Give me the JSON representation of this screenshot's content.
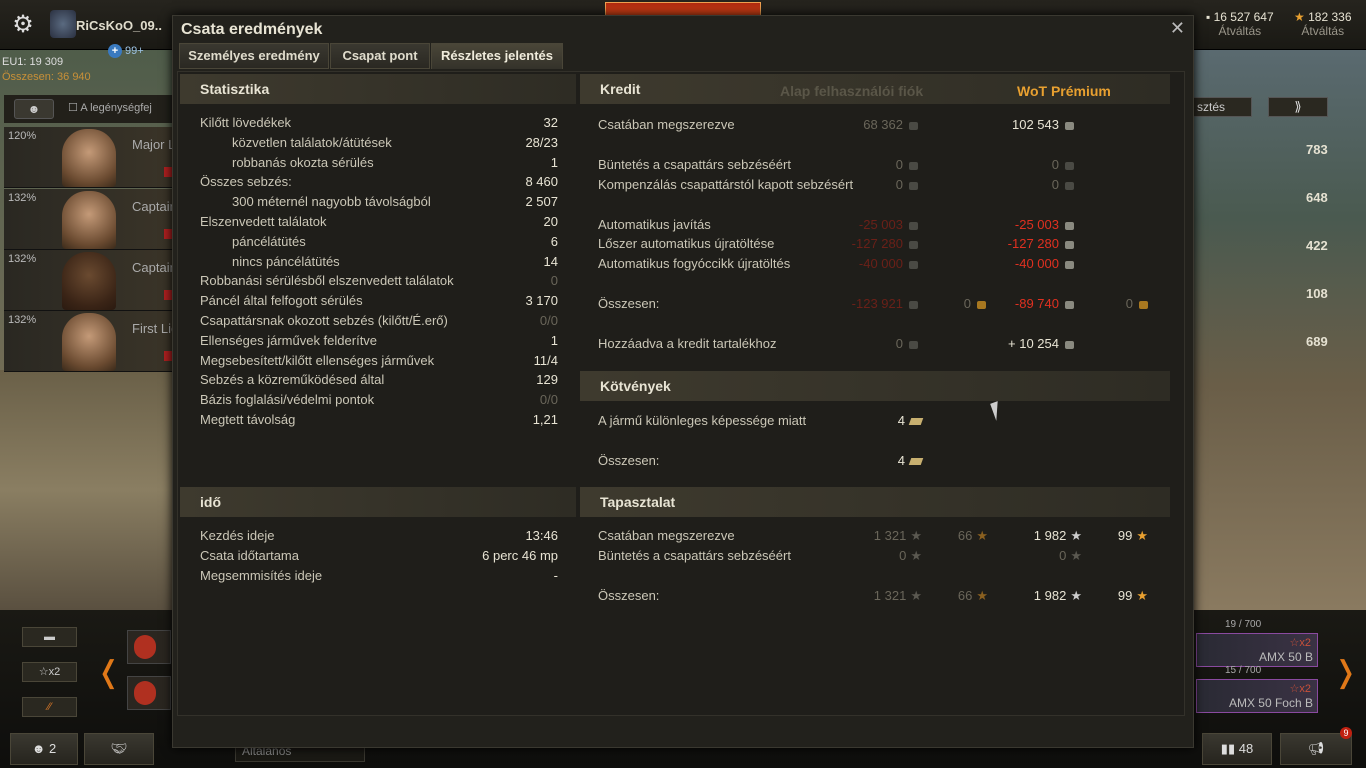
{
  "topbar": {
    "player_name": "RiCsKoO_09..",
    "invites_badge": "99+",
    "currencies": [
      {
        "value": "16 527 647",
        "label": "Átváltás"
      },
      {
        "value": "182 336",
        "label": "Átváltás"
      }
    ]
  },
  "left_stats": {
    "line1": "EU1: 19 309",
    "line2": "Összesen: 36 940"
  },
  "crew_filter": {
    "label": "A legénységfej"
  },
  "crew": [
    {
      "pct": "120%",
      "rank": "Major L"
    },
    {
      "pct": "132%",
      "rank": "Captain"
    },
    {
      "pct": "132%",
      "rank": "Captain"
    },
    {
      "pct": "132%",
      "rank": "First Lie"
    }
  ],
  "right_panel": {
    "button1": "sztés",
    "values": [
      "783",
      "648",
      "422",
      "108",
      "689"
    ]
  },
  "bottom": {
    "x2_label": "x2",
    "platoon_count": "2",
    "chat_channel": "Általános",
    "tank_cards": [
      {
        "xp": "19 / 700",
        "name": "AMX 50 B",
        "x2": "x2"
      },
      {
        "xp": "15 / 700",
        "name": "AMX 50 Foch B",
        "x2": "x2"
      }
    ],
    "sessions_count": "48",
    "notif_count": "9"
  },
  "dialog": {
    "title": "Csata eredmények",
    "tabs": [
      "Személyes eredmény",
      "Csapat pont",
      "Részletes jelentés"
    ],
    "stats": {
      "header": "Statisztika",
      "rows": [
        {
          "label": "Kilőtt lövedékek",
          "value": "32",
          "indent": false,
          "dim": false
        },
        {
          "label": "közvetlen találatok/átütések",
          "value": "28/23",
          "indent": true,
          "dim": false
        },
        {
          "label": "robbanás okozta sérülés",
          "value": "1",
          "indent": true,
          "dim": false
        },
        {
          "label": "Összes sebzés:",
          "value": "8 460",
          "indent": false,
          "dim": false
        },
        {
          "label": "300 méternél nagyobb távolságból",
          "value": "2 507",
          "indent": true,
          "dim": false
        },
        {
          "label": "Elszenvedett találatok",
          "value": "20",
          "indent": false,
          "dim": false
        },
        {
          "label": "páncélátütés",
          "value": "6",
          "indent": true,
          "dim": false
        },
        {
          "label": "nincs páncélátütés",
          "value": "14",
          "indent": true,
          "dim": false
        },
        {
          "label": "Robbanási sérülésből elszenvedett találatok",
          "value": "0",
          "indent": false,
          "dim": true
        },
        {
          "label": "Páncél által felfogott sérülés",
          "value": "3 170",
          "indent": false,
          "dim": false
        },
        {
          "label": "Csapattársnak okozott sebzés (kilőtt/É.erő)",
          "value": "0/0",
          "indent": false,
          "dim": true
        },
        {
          "label": "Ellenséges járművek felderítve",
          "value": "1",
          "indent": false,
          "dim": false
        },
        {
          "label": "Megsebesített/kilőtt ellenséges járművek",
          "value": "11/4",
          "indent": false,
          "dim": false
        },
        {
          "label": "Sebzés a közreműködésed által",
          "value": "129",
          "indent": false,
          "dim": false
        },
        {
          "label": "Bázis foglalási/védelmi pontok",
          "value": "0/0",
          "indent": false,
          "dim": true
        },
        {
          "label": "Megtett távolság",
          "value": "1,21",
          "indent": false,
          "dim": false
        }
      ]
    },
    "time": {
      "header": "idő",
      "rows": [
        {
          "label": "Kezdés ideje",
          "value": "13:46"
        },
        {
          "label": "Csata időtartama",
          "value": "6 perc 46 mp"
        },
        {
          "label": "Megsemmisítés ideje",
          "value": "-"
        }
      ]
    },
    "credit": {
      "header": "Kredit",
      "col_basic": "Alap felhasználói fiók",
      "col_premium": "WoT Prémium",
      "earned": {
        "label": "Csatában megszerezve",
        "basic": "68 362",
        "premium": "102 543"
      },
      "penalty": {
        "label": "Büntetés a csapattárs sebzéséért",
        "basic": "0",
        "premium": "0"
      },
      "compensation": {
        "label": "Kompenzálás csapattárstól kapott sebzésért",
        "basic": "0",
        "premium": "0"
      },
      "repair": {
        "label": "Automatikus javítás",
        "basic": "-25 003",
        "premium": "-25 003"
      },
      "ammo": {
        "label": "Lőszer automatikus újratöltése",
        "basic": "-127 280",
        "premium": "-127 280"
      },
      "consumables": {
        "label": "Automatikus fogyóccikk újratöltés",
        "basic": "-40 000",
        "premium": "-40 000"
      },
      "total": {
        "label": "Összesen:",
        "basic": "-123 921",
        "basic_gold": "0",
        "premium": "-89 740",
        "premium_gold": "0"
      },
      "added": {
        "label": "Hozzáadva a kredit tartalékhoz",
        "basic": "0",
        "premium": "+ 10 254"
      }
    },
    "bonds": {
      "header": "Kötvények",
      "special": {
        "label": "A jármű különleges képessége miatt",
        "value": "4"
      },
      "total": {
        "label": "Összesen:",
        "value": "4"
      }
    },
    "xp": {
      "header": "Tapasztalat",
      "earned": {
        "label": "Csatában megszerezve",
        "basic": "1 321",
        "basic_free": "66",
        "premium": "1 982",
        "premium_free": "99"
      },
      "penalty": {
        "label": "Büntetés a csapattárs sebzéséért",
        "basic": "0",
        "premium": "0"
      },
      "total": {
        "label": "Összesen:",
        "basic": "1 321",
        "basic_free": "66",
        "premium": "1 982",
        "premium_free": "99"
      }
    }
  }
}
